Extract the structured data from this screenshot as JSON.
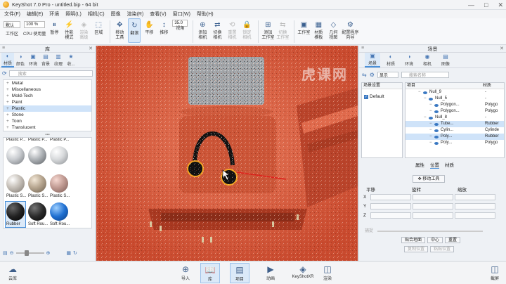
{
  "title": "KeyShot 7.0 Pro  -  untitled.bip  -  64 bit",
  "window_controls": [
    "—",
    "□",
    "✕"
  ],
  "menu": [
    "文件(F)",
    "编辑(E)",
    "环境",
    "照明(L)",
    "相机(C)",
    "图像",
    "渲染(R)",
    "查看(V)",
    "窗口(W)",
    "帮助(H)"
  ],
  "toolbar": {
    "workspace_select": "默认",
    "zoom_select": "100 %",
    "fov_value": "35.0",
    "items": [
      {
        "label": "工作区",
        "icon": "workspace-icon"
      },
      {
        "label": "CPU 使用量",
        "icon": "cpu-icon"
      },
      {
        "label": "暂停",
        "icon": "pause-icon"
      },
      {
        "label": "性能\n模式",
        "icon": "performance-icon"
      },
      {
        "label": "渲染\n高级",
        "icon": "render-adv-icon",
        "disabled": true
      },
      {
        "label": "区域",
        "icon": "region-icon"
      },
      {
        "label": "移动\n工具",
        "icon": "move-tool-icon"
      },
      {
        "label": "翻滚",
        "icon": "tumble-icon",
        "active": true
      },
      {
        "label": "平移",
        "icon": "pan-icon"
      },
      {
        "label": "推移",
        "icon": "dolly-icon"
      },
      {
        "label": "视角",
        "icon": "perspective-icon"
      },
      {
        "label": "添加\n相机",
        "icon": "add-camera-icon"
      },
      {
        "label": "切换\n相机",
        "icon": "switch-camera-icon"
      },
      {
        "label": "重置\n相机",
        "icon": "reset-camera-icon",
        "disabled": true
      },
      {
        "label": "锁定\n相机",
        "icon": "lock-camera-icon",
        "disabled": true
      },
      {
        "label": "添加\n工作室",
        "icon": "add-studio-icon"
      },
      {
        "label": "切换\n工作室",
        "icon": "switch-studio-icon",
        "disabled": true
      },
      {
        "label": "工作室",
        "icon": "studio-icon"
      },
      {
        "label": "材质\n模板",
        "icon": "material-template-icon"
      },
      {
        "label": "几何\n视图",
        "icon": "geometry-view-icon"
      },
      {
        "label": "配置程序\n向导",
        "icon": "configurator-icon"
      }
    ]
  },
  "watermark": "虎课网",
  "library": {
    "title": "库",
    "tabs": [
      "材质",
      "颜色",
      "环境",
      "背景",
      "纹理",
      "收..."
    ],
    "search_placeholder": "搜索",
    "tree": [
      "Metal",
      "Miscellaneous",
      "Mold-Tech",
      "Paint",
      "Plastic",
      "Stone",
      "Toon",
      "Translucent"
    ],
    "selected_tree": "Plastic",
    "grid": [
      {
        "label": "Plastic P...",
        "ball": "g1"
      },
      {
        "label": "Plastic P...",
        "ball": "g2"
      },
      {
        "label": "Plastic P...",
        "ball": "g3"
      },
      {
        "label": "Plastic S...",
        "ball": "s1"
      },
      {
        "label": "Plastic S...",
        "ball": "s2"
      },
      {
        "label": "Plastic S...",
        "ball": "s3"
      },
      {
        "label": "Rubber",
        "ball": "r1"
      },
      {
        "label": "Soft Rou...",
        "ball": "r2"
      },
      {
        "label": "Soft Rou...",
        "ball": "r3"
      }
    ],
    "selected_grid": "Rubber"
  },
  "scene": {
    "title": "场景",
    "tabs": [
      "场景",
      "材质",
      "环境",
      "相机",
      "图像"
    ],
    "dropdown": "显示",
    "search_placeholder": "搜索名称",
    "env_header": "场景设置",
    "env_item": "Default",
    "tree_header": [
      "项目",
      "材质"
    ],
    "tree_rows": [
      {
        "name": "Null_9",
        "mat": "-",
        "indent": 2,
        "on": false
      },
      {
        "name": "Null_5",
        "mat": "-",
        "indent": 3,
        "on": false
      },
      {
        "name": "Polygon...",
        "mat": "Polygo",
        "indent": 4,
        "on": false
      },
      {
        "name": "Polygon...",
        "mat": "Polygo",
        "indent": 4,
        "on": false
      },
      {
        "name": "Null_8",
        "mat": "-",
        "indent": 3,
        "on": false
      },
      {
        "name": "Tube...",
        "mat": "Rubber",
        "indent": 4,
        "on": true
      },
      {
        "name": "Cylin...",
        "mat": "Cylinde",
        "indent": 4,
        "on": false
      },
      {
        "name": "Poly...",
        "mat": "Rubber",
        "indent": 4,
        "on": true
      },
      {
        "name": "Poly...",
        "mat": "Polygo",
        "indent": 4,
        "on": false
      }
    ],
    "props_tabs": [
      "属性",
      "位置",
      "材质"
    ],
    "active_prop_tab": "位置",
    "move_tool": "移动工具",
    "columns": [
      "平移",
      "旋转",
      "缩放"
    ],
    "axes": [
      "X",
      "Y",
      "Z"
    ],
    "slider_label": "捕捉",
    "buttons_row1": [
      "贴合地面",
      "中心",
      "重置"
    ],
    "buttons_row2": [
      "复制位置",
      "粘贴位置"
    ]
  },
  "bottom": {
    "left": {
      "label": "云库",
      "icon": "cloud-library-icon"
    },
    "center": [
      {
        "label": "导入",
        "icon": "import-icon"
      },
      {
        "label": "库",
        "icon": "library-icon",
        "active": true
      },
      {
        "label": "项目",
        "icon": "project-icon",
        "active": true
      },
      {
        "label": "动画",
        "icon": "animation-icon"
      },
      {
        "label": "KeyShotXR",
        "icon": "keyshotxr-icon"
      },
      {
        "label": "渲染",
        "icon": "render-icon"
      }
    ],
    "right": {
      "label": "截屏",
      "icon": "screenshot-icon"
    }
  },
  "colors": {
    "accent": "#4a90d9",
    "viewport_bg": "#d8583a",
    "selection_outline": "#f5a623"
  }
}
